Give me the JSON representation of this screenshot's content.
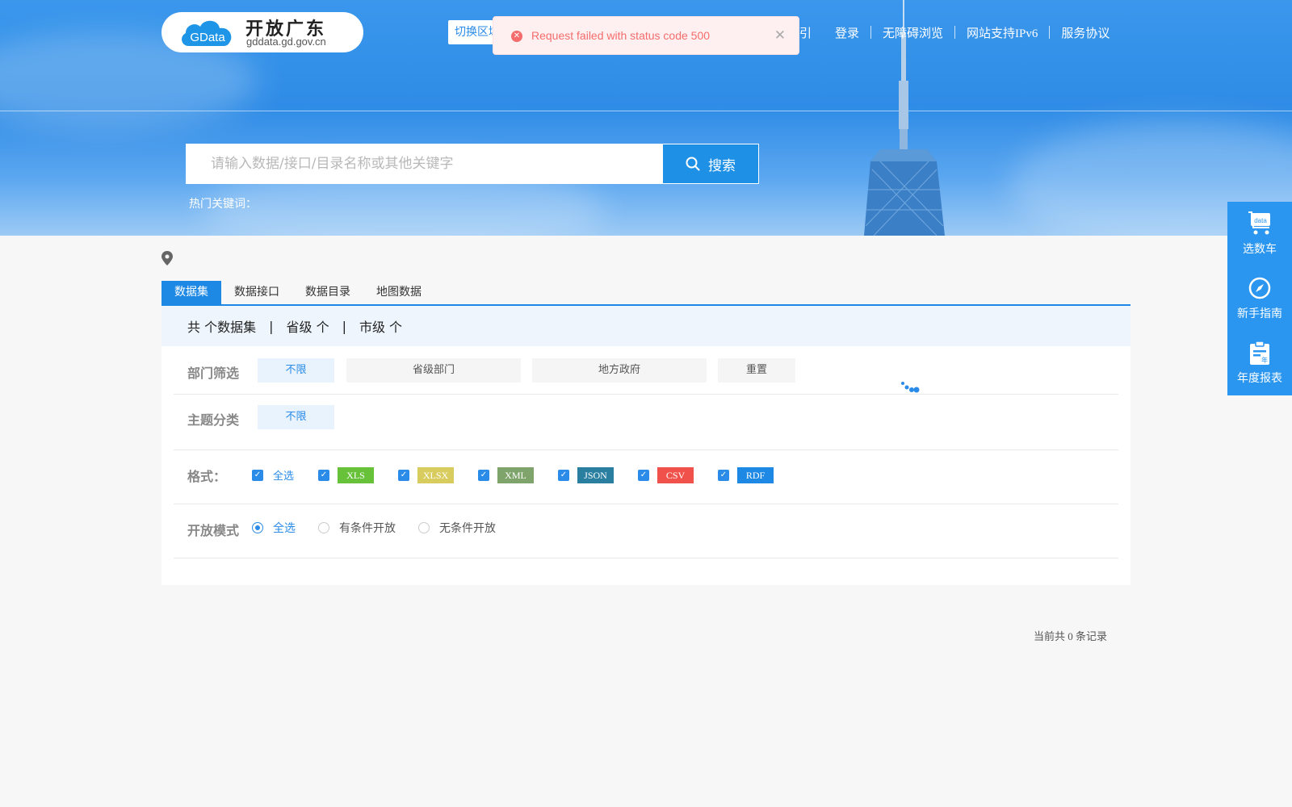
{
  "header": {
    "logo_badge": "GData",
    "logo_title": "开放广东",
    "logo_subtitle": "gddata.gd.gov.cn",
    "switch_region": "切换区域",
    "nav": [
      "指引",
      "登录",
      "无障碍浏览",
      "网站支持IPv6",
      "服务协议"
    ]
  },
  "toast": {
    "type": "error",
    "icon": "error-circle-icon",
    "message": "Request failed with status code 500",
    "close_icon": "close-icon"
  },
  "search": {
    "placeholder": "请输入数据/接口/目录名称或其他关键字",
    "value": "",
    "button_label": "搜索",
    "hot_keywords_label": "热门关键词："
  },
  "tabs": [
    {
      "label": "数据集",
      "active": true
    },
    {
      "label": "数据接口",
      "active": false
    },
    {
      "label": "数据目录",
      "active": false
    },
    {
      "label": "地图数据",
      "active": false
    }
  ],
  "summary": {
    "total": "共 个数据集",
    "provincial": "省级 个",
    "city": "市级 个",
    "separator": "|"
  },
  "filters": {
    "department": {
      "label": "部门筛选",
      "options": [
        {
          "label": "不限",
          "active": true
        },
        {
          "label": "省级部门",
          "active": false
        },
        {
          "label": "地方政府",
          "active": false
        },
        {
          "label": "重置",
          "active": false
        }
      ]
    },
    "topic": {
      "label": "主题分类",
      "options": [
        {
          "label": "不限",
          "active": true
        }
      ]
    },
    "format": {
      "label": "格式：",
      "select_all": "全选",
      "items": [
        {
          "label": "XLS",
          "color": "#67c23a",
          "checked": true
        },
        {
          "label": "XLSX",
          "color": "#d9cc5f",
          "checked": true
        },
        {
          "label": "XML",
          "color": "#7ea36b",
          "checked": true
        },
        {
          "label": "JSON",
          "color": "#2a7fa0",
          "checked": true
        },
        {
          "label": "CSV",
          "color": "#f0524b",
          "checked": true
        },
        {
          "label": "RDF",
          "color": "#1e88e5",
          "checked": true
        }
      ]
    },
    "open_mode": {
      "label": "开放模式",
      "options": [
        {
          "label": "全选",
          "selected": true
        },
        {
          "label": "有条件开放",
          "selected": false
        },
        {
          "label": "无条件开放",
          "selected": false
        }
      ]
    }
  },
  "pagination": {
    "records_text": "当前共 0 条记录"
  },
  "side_bar": [
    {
      "label": "选数车",
      "icon": "data-cart-icon"
    },
    {
      "label": "新手指南",
      "icon": "compass-icon"
    },
    {
      "label": "年度报表",
      "icon": "annual-report-icon"
    }
  ],
  "colors": {
    "primary": "#1e88e5",
    "error": "#f56c6c",
    "side": "#2a96f0"
  }
}
